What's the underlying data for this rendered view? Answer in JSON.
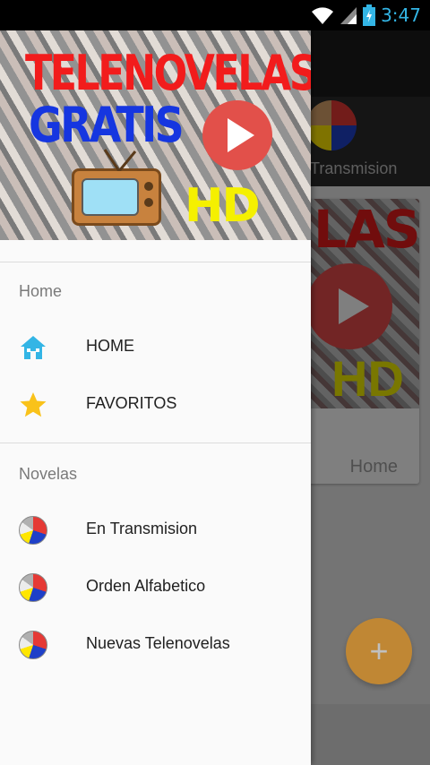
{
  "status_bar": {
    "time": "3:47"
  },
  "app": {
    "tab_label": "Transmision",
    "card": {
      "title": "LAS",
      "badge": "HD",
      "footer_label": "Home"
    },
    "fab_label": "+"
  },
  "drawer": {
    "header": {
      "line1": "TELENOVELAS",
      "line2": "GRATIS",
      "hd": "HD"
    },
    "sections": [
      {
        "title": "Home",
        "items": [
          {
            "label": "HOME",
            "icon": "home-icon"
          },
          {
            "label": "FAVORITOS",
            "icon": "star-icon"
          }
        ]
      },
      {
        "title": "Novelas",
        "items": [
          {
            "label": "En Transmision",
            "icon": "novela-icon"
          },
          {
            "label": "Orden Alfabetico",
            "icon": "novela-icon"
          },
          {
            "label": "Nuevas Telenovelas",
            "icon": "novela-icon"
          }
        ]
      }
    ]
  },
  "colors": {
    "accent": "#33b5e5",
    "fab": "#ff9800",
    "home_icon": "#33b5e5",
    "star_icon": "#f9c21a"
  }
}
